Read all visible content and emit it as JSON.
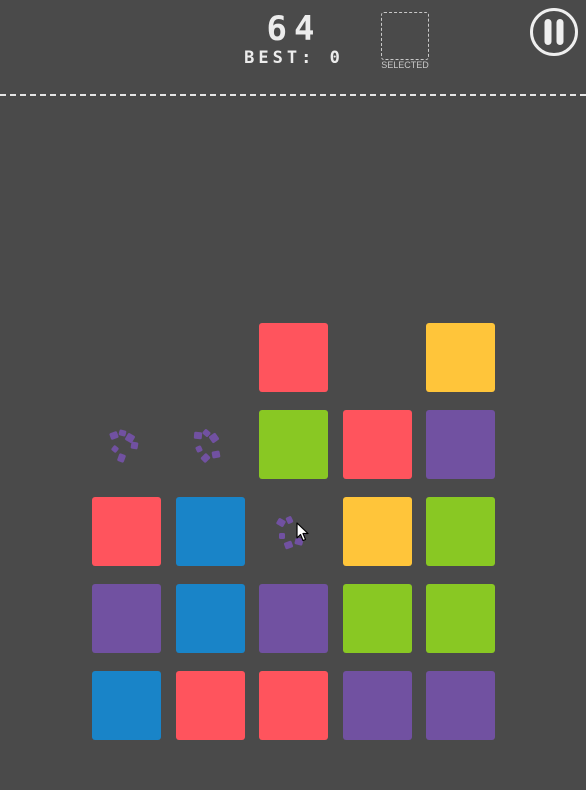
{
  "hud": {
    "score": "64",
    "best_label": "BEST:",
    "best_value": "0",
    "selected_label": "SELECTED",
    "pause_icon": "pause-icon"
  },
  "colors": {
    "background": "#4a4a4a",
    "red": "#ff545d",
    "blue": "#1984c8",
    "purple": "#7151a1",
    "green": "#89c823",
    "yellow": "#ffc53a",
    "text": "#ececec"
  },
  "board": {
    "columns": 5,
    "rows": 5,
    "grid": [
      [
        null,
        null,
        "red",
        null,
        "yellow"
      ],
      [
        null,
        null,
        "green",
        "red",
        "purple"
      ],
      [
        "red",
        "blue",
        null,
        "yellow",
        "green"
      ],
      [
        "purple",
        "blue",
        "purple",
        "green",
        "green"
      ],
      [
        "blue",
        "red",
        "red",
        "purple",
        "purple"
      ]
    ],
    "debris": [
      {
        "row": 1,
        "col": 0,
        "color": "purple"
      },
      {
        "row": 1,
        "col": 1,
        "color": "purple"
      },
      {
        "row": 2,
        "col": 2,
        "color": "purple"
      }
    ]
  }
}
